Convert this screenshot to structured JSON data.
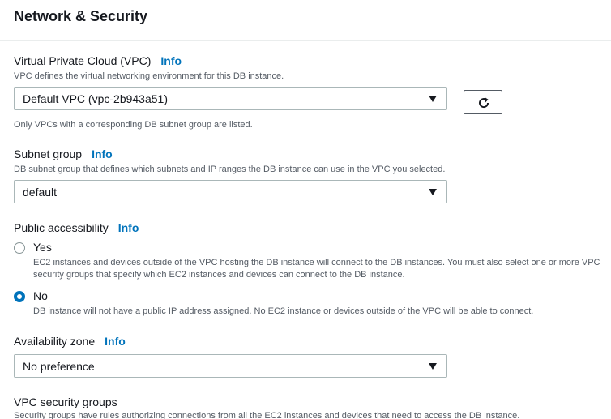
{
  "section": {
    "title": "Network & Security"
  },
  "info_label": "Info",
  "vpc": {
    "label": "Virtual Private Cloud (VPC)",
    "description": "VPC defines the virtual networking environment for this DB instance.",
    "selected": "Default VPC (vpc-2b943a51)",
    "hint": "Only VPCs with a corresponding DB subnet group are listed."
  },
  "subnet": {
    "label": "Subnet group",
    "description": "DB subnet group that defines which subnets and IP ranges the DB instance can use in the VPC you selected.",
    "selected": "default"
  },
  "public_access": {
    "label": "Public accessibility",
    "options": [
      {
        "label": "Yes",
        "description": "EC2 instances and devices outside of the VPC hosting the DB instance will connect to the DB instances. You must also select one or more VPC security groups that specify which EC2 instances and devices can connect to the DB instance.",
        "checked": false
      },
      {
        "label": "No",
        "description": "DB instance will not have a public IP address assigned. No EC2 instance or devices outside of the VPC will be able to connect.",
        "checked": true
      }
    ]
  },
  "availability_zone": {
    "label": "Availability zone",
    "selected": "No preference"
  },
  "security_groups": {
    "label": "VPC security groups",
    "description": "Security groups have rules authorizing connections from all the EC2 instances and devices that need to access the DB instance."
  },
  "icons": {
    "refresh": "refresh-icon",
    "caret": "caret-down-icon"
  },
  "colors": {
    "link": "#0073bb",
    "text": "#16191f",
    "muted": "#545b64",
    "border": "#aab7b8"
  }
}
